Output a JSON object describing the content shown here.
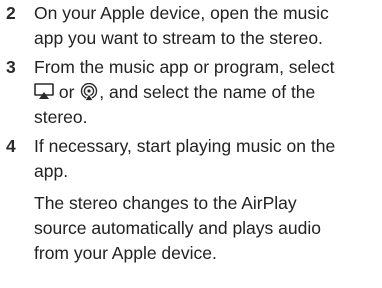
{
  "steps": [
    {
      "number": "2",
      "lines": [
        "On your Apple device, open the music",
        "app you want to stream to the stereo."
      ]
    },
    {
      "number": "3",
      "line1": "From the music app or program, select",
      "line2_before": "",
      "line2_middle": " or ",
      "line2_after": ", and select the name of the",
      "line3": "stereo.",
      "icons": [
        "airplay-video-icon",
        "airplay-audio-icon"
      ]
    },
    {
      "number": "4",
      "lines": [
        "If necessary, start playing music on the",
        "app."
      ],
      "note_lines": [
        "The stereo changes to the AirPlay",
        "source automatically and plays audio",
        "from your Apple device."
      ]
    }
  ]
}
